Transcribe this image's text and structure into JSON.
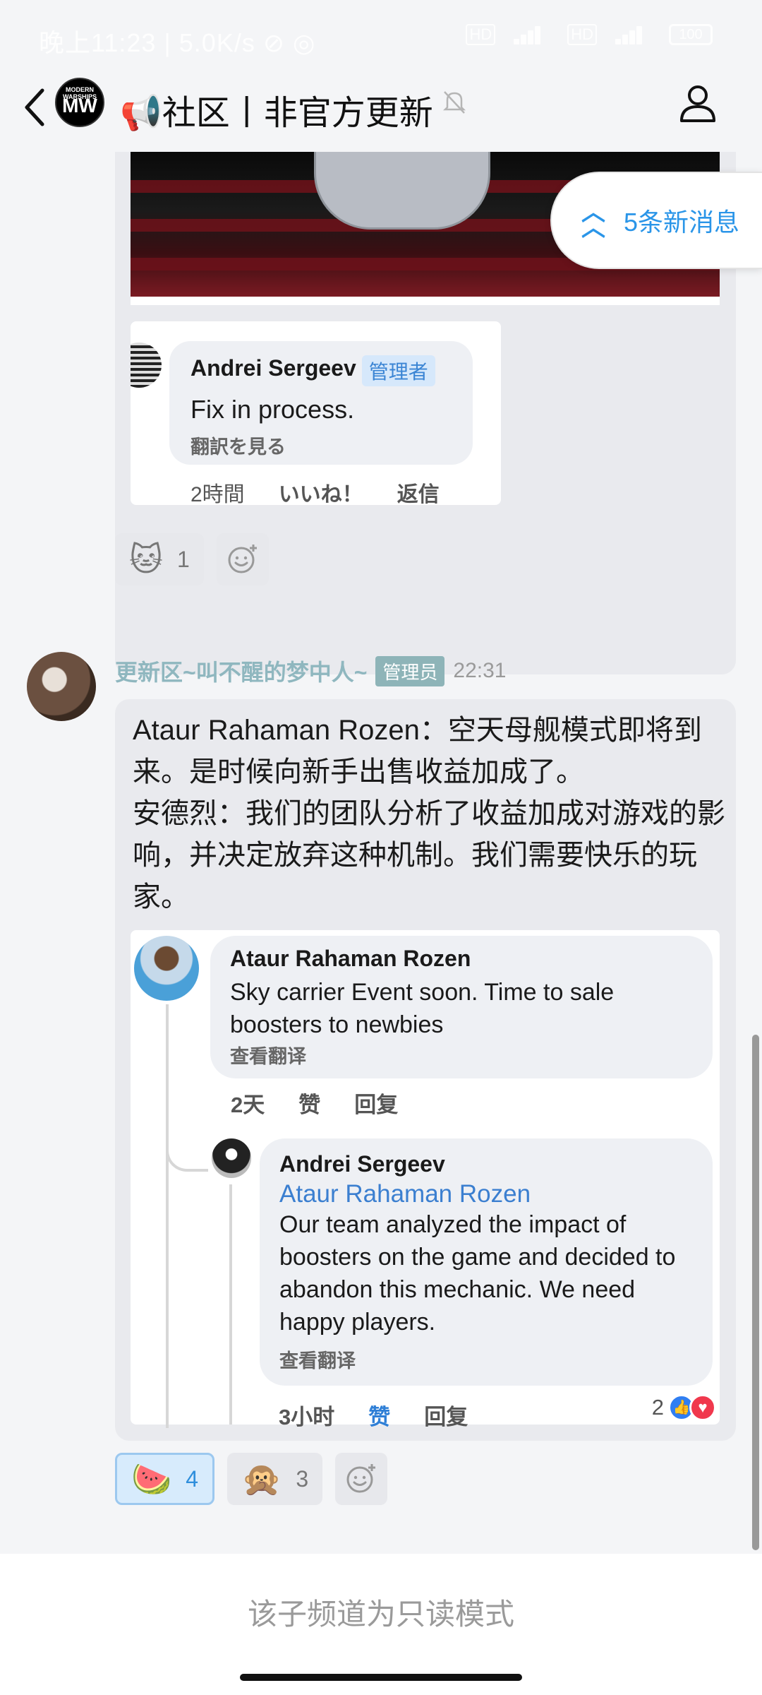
{
  "status_bar": {
    "time": "晚上11:23",
    "speed": "5.0K/s",
    "battery": "100"
  },
  "header": {
    "channel_logo": "MODERN WARSHIPS",
    "title": "📢社区丨非官方更新",
    "mute_icon": "bell-off-icon",
    "profile_icon": "person-icon"
  },
  "new_messages": {
    "label": "5条新消息"
  },
  "post1": {
    "quote": {
      "name": "Andrei Sergeev",
      "role": "管理者",
      "text": "Fix in process.",
      "translate": "翻訳を見る",
      "time": "2時間",
      "like": "いいね！",
      "reply": "返信"
    },
    "reactions": [
      {
        "emoji": "🐱",
        "count": "1"
      }
    ]
  },
  "post2": {
    "author": "更新区~叫不醒的梦中人~",
    "role": "管理员",
    "time": "22:31",
    "text_line1": "Ataur Rahaman Rozen：空天母舰模式即将到来。是时候向新手出售收益加成了。",
    "text_line2": "安德烈：我们的团队分析了收益加成对游戏的影响，并决定放弃这种机制。我们需要快乐的玩家。",
    "comment": {
      "name": "Ataur Rahaman Rozen",
      "text": "Sky carrier Event soon. Time to sale boosters to newbies",
      "translate": "查看翻译",
      "time": "2天",
      "like": "赞",
      "reply": "回复"
    },
    "reply": {
      "name": "Andrei Sergeev",
      "mention": "Ataur Rahaman Rozen",
      "text": "Our team analyzed the impact of boosters on the game and decided to abandon this mechanic. We need happy players.",
      "translate": "查看翻译",
      "time": "3小时",
      "like": "赞",
      "reply": "回复",
      "reaction_count": "2"
    },
    "reactions": [
      {
        "emoji": "🍉",
        "count": "4"
      },
      {
        "emoji": "🙊",
        "count": "3"
      }
    ]
  },
  "footer": {
    "readonly": "该子频道为只读模式"
  }
}
